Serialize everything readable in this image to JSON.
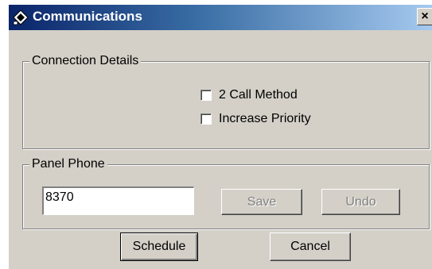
{
  "window": {
    "title": "Communications",
    "app_icon": "app-diamond-icon",
    "close_glyph": "×"
  },
  "connection_details": {
    "label": "Connection Details",
    "options": [
      {
        "label": "2 Call Method",
        "checked": false
      },
      {
        "label": "Increase Priority",
        "checked": false
      }
    ]
  },
  "panel_phone": {
    "label": "Panel Phone",
    "value": "8370",
    "save_label": "Save",
    "undo_label": "Undo"
  },
  "footer": {
    "schedule_label": "Schedule",
    "cancel_label": "Cancel"
  },
  "colors": {
    "title_bar_start": "#0a246a",
    "title_bar_end": "#a6caf0",
    "dialog_face": "#d4d0c8"
  }
}
